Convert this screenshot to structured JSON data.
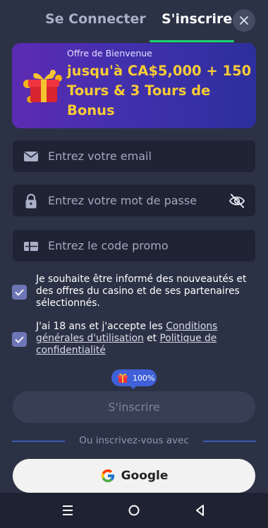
{
  "header": {
    "tabs": [
      {
        "label": "Se Connecter",
        "active": false
      },
      {
        "label": "S'inscrire",
        "active": true
      }
    ],
    "close_icon": "close-icon"
  },
  "banner": {
    "subtitle": "Offre de Bienvenue",
    "title": "jusqu'à CA$5,000 + 150 Tours & 3 Tours de Bonus",
    "icon": "gift-icon"
  },
  "form": {
    "email_placeholder": "Entrez votre email",
    "password_placeholder": "Entrez votre mot de passe",
    "promo_placeholder": "Entrez le code promo"
  },
  "consents": {
    "newsletter": {
      "checked": true,
      "text": "Je souhaite être informé des nouveautés et des offres du casino et de ses partenaires sélectionnés."
    },
    "terms": {
      "checked": true,
      "prefix": "J'ai 18 ans et j'accepte les ",
      "link1": "Conditions générales d'utilisation",
      "middle": " et ",
      "link2": "Politique de confidentialité"
    }
  },
  "bonus_badge": {
    "percent": "100%"
  },
  "submit_label": "S'inscrire",
  "divider_text": "Ou inscrivez-vous avec",
  "google_label": "Google",
  "colors": {
    "accent_green": "#1fd37a",
    "banner_gold": "#f8cc34",
    "background": "#2c3246",
    "input_bg": "#1f2333",
    "checkbox": "#6d76b5"
  }
}
